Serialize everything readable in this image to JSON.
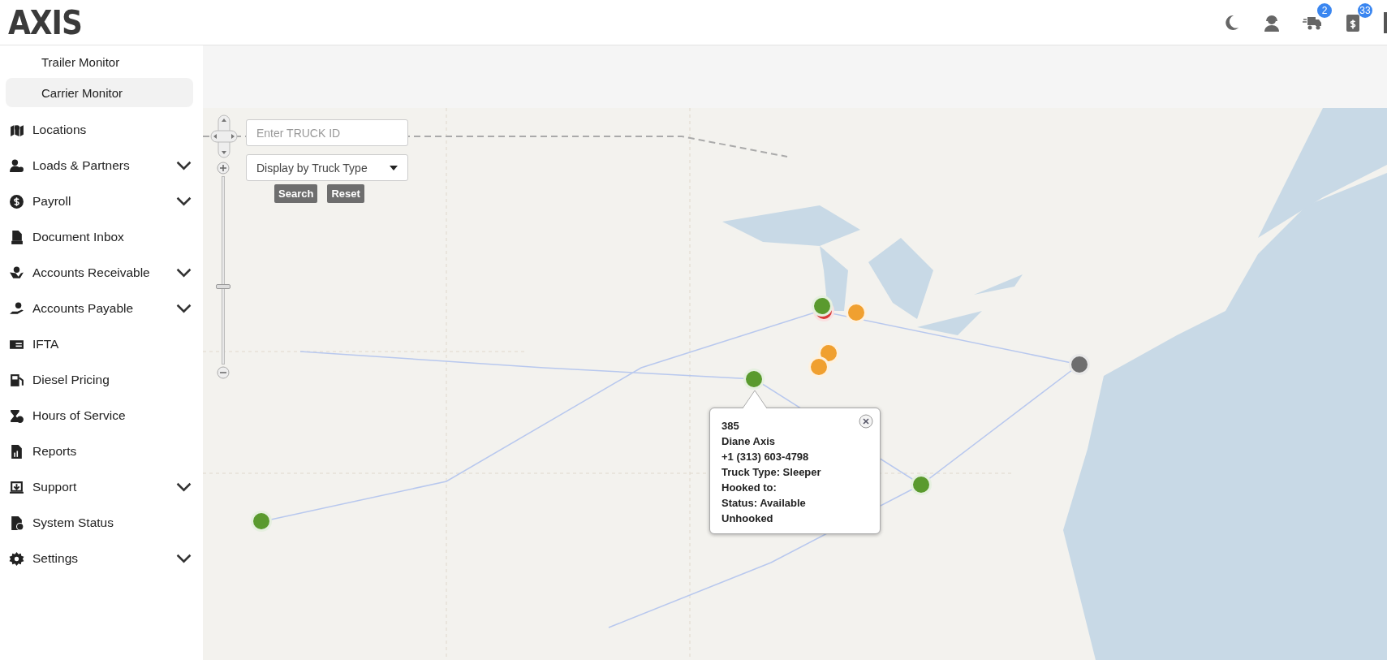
{
  "header": {
    "logo": "AXIS",
    "notifications": [
      {
        "kind": "truck",
        "badge": "2"
      },
      {
        "kind": "billing",
        "badge": "33"
      }
    ]
  },
  "sidebar": {
    "subitems": [
      {
        "label": "Trailer Monitor",
        "selected": false
      },
      {
        "label": "Carrier Monitor",
        "selected": true
      }
    ],
    "items": [
      {
        "label": "Locations",
        "expandable": false
      },
      {
        "label": "Loads & Partners",
        "expandable": true
      },
      {
        "label": "Payroll",
        "expandable": true
      },
      {
        "label": "Document Inbox",
        "expandable": false
      },
      {
        "label": "Accounts Receivable",
        "expandable": true
      },
      {
        "label": "Accounts Payable",
        "expandable": true
      },
      {
        "label": "IFTA",
        "expandable": false
      },
      {
        "label": "Diesel Pricing",
        "expandable": false
      },
      {
        "label": "Hours of Service",
        "expandable": false
      },
      {
        "label": "Reports",
        "expandable": false
      },
      {
        "label": "Support",
        "expandable": true
      },
      {
        "label": "System Status",
        "expandable": false
      },
      {
        "label": "Settings",
        "expandable": true
      }
    ]
  },
  "map": {
    "zoom": {
      "level": 0.41
    },
    "search": {
      "placeholder": "Enter TRUCK ID"
    },
    "filter": {
      "value": "Display by Truck Type"
    },
    "buttons": [
      "Search",
      "Reset"
    ],
    "markers": [
      {
        "color": "#d93a3a"
      },
      {
        "color": "#5a9a2e"
      },
      {
        "color": "#f0a030"
      },
      {
        "color": "#f0a030"
      },
      {
        "color": "#f0a030"
      },
      {
        "color": "#5a9a2e"
      },
      {
        "color": "#6e6e6e"
      },
      {
        "color": "#5a9a2e"
      },
      {
        "color": "#5a9a2e"
      }
    ],
    "popup": {
      "lines": [
        "385",
        "Diane Axis",
        "+1 (313) 603-4798",
        "Truck Type: Sleeper",
        "Hooked to:",
        "Status: Available",
        "Unhooked"
      ]
    }
  }
}
